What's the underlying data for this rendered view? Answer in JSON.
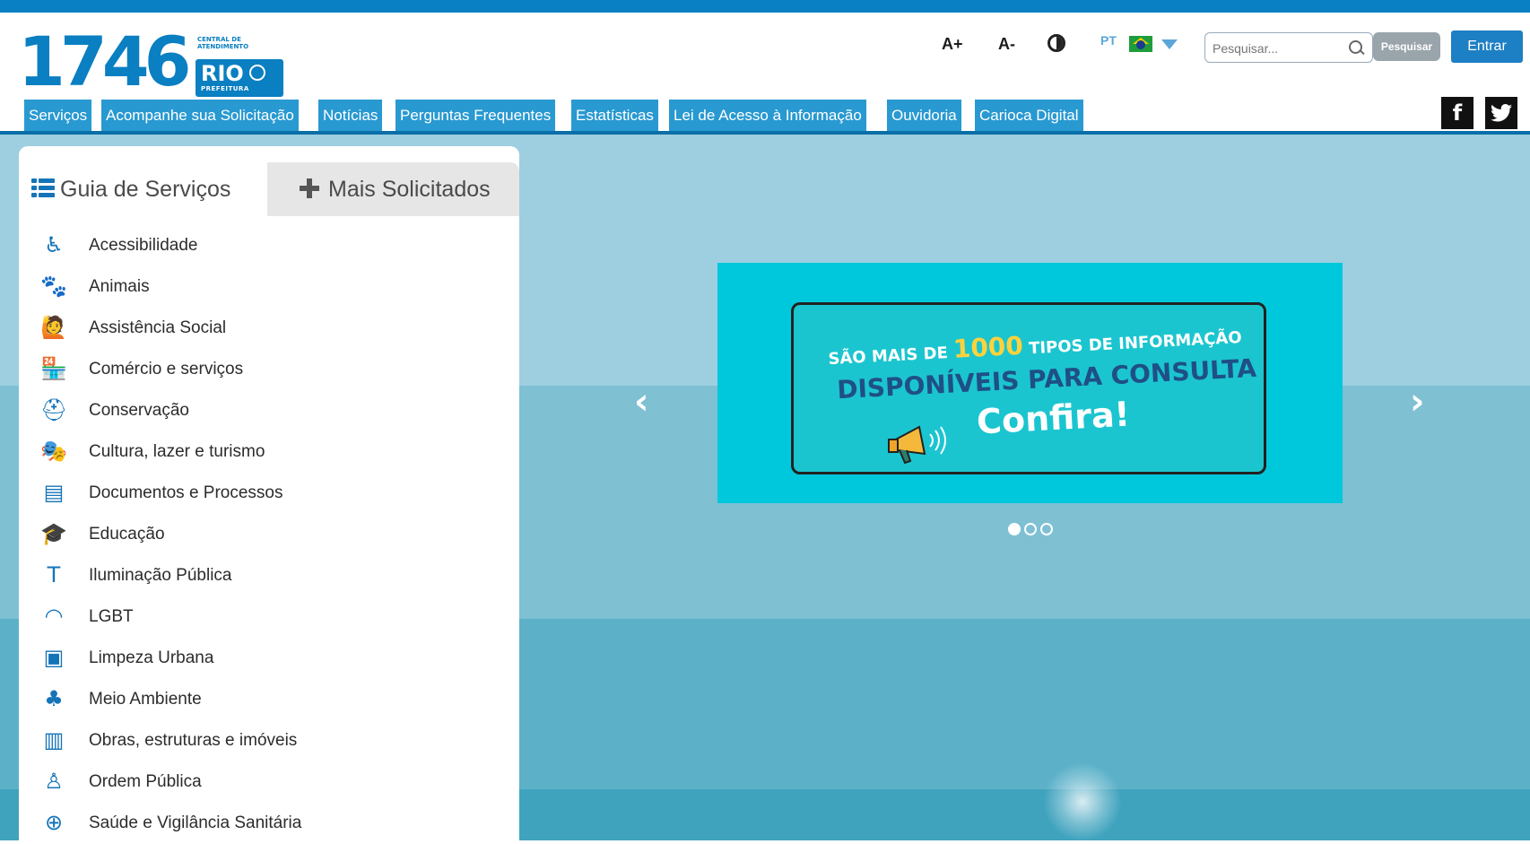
{
  "logo": {
    "number": "1746",
    "central": "CENTRAL DE ATENDIMENTO",
    "rio": "RIO",
    "prefeitura": "PREFEITURA"
  },
  "toolbar": {
    "font_increase": "A+",
    "font_decrease": "A-",
    "language": "PT",
    "search_placeholder": "Pesquisar...",
    "search_button": "Pesquisar",
    "login_button": "Entrar"
  },
  "nav": {
    "items": [
      "Serviços",
      "Acompanhe sua Solicitação",
      "Notícias",
      "Perguntas Frequentes",
      "Estatísticas",
      "Lei de Acesso à Informação",
      "Ouvidoria",
      "Carioca Digital"
    ]
  },
  "social": {
    "facebook": "f",
    "twitter": "t"
  },
  "panel": {
    "tab_active": "Guia de Serviços",
    "tab_inactive": "Mais Solicitados",
    "services": [
      {
        "label": "Acessibilidade",
        "icon": "wheelchair-icon"
      },
      {
        "label": "Animais",
        "icon": "paw-icon"
      },
      {
        "label": "Assistência Social",
        "icon": "social-assistance-icon"
      },
      {
        "label": "Comércio e serviços",
        "icon": "store-icon"
      },
      {
        "label": "Conservação",
        "icon": "hardhat-icon"
      },
      {
        "label": "Cultura, lazer e turismo",
        "icon": "theater-masks-icon"
      },
      {
        "label": "Documentos e Processos",
        "icon": "document-icon"
      },
      {
        "label": "Educação",
        "icon": "graduation-cap-icon"
      },
      {
        "label": "Iluminação Pública",
        "icon": "streetlight-icon"
      },
      {
        "label": "LGBT",
        "icon": "rainbow-icon"
      },
      {
        "label": "Limpeza Urbana",
        "icon": "garbage-truck-icon"
      },
      {
        "label": "Meio Ambiente",
        "icon": "sprout-icon"
      },
      {
        "label": "Obras, estruturas e imóveis",
        "icon": "buildings-icon"
      },
      {
        "label": "Ordem Pública",
        "icon": "officer-icon"
      },
      {
        "label": "Saúde e Vigilância Sanitária",
        "icon": "health-cross-icon"
      }
    ]
  },
  "carousel": {
    "line1_pre": "SÃO MAIS DE ",
    "line1_number": "1000",
    "line1_post": " TIPOS DE INFORMAÇÃO",
    "line2": "DISPONÍVEIS PARA CONSULTA",
    "line3": "Confira!",
    "active_slide": 1,
    "slide_count": 3
  },
  "colors": {
    "brand": "#0a80c4",
    "nav_bg": "#2899d1",
    "icon": "#1574b8",
    "slide_bg": "#00c8dc",
    "highlight": "#ffd23c"
  }
}
